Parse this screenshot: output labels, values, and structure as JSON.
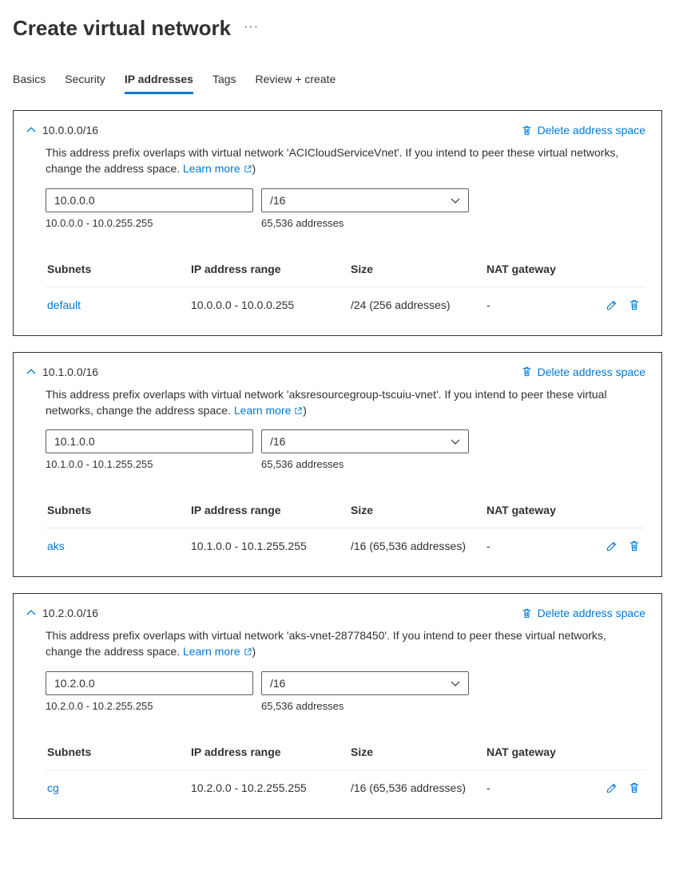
{
  "page_title": "Create virtual network",
  "tabs": {
    "basics": "Basics",
    "security": "Security",
    "ip_addresses": "IP addresses",
    "tags": "Tags",
    "review_create": "Review + create"
  },
  "delete_label": "Delete address space",
  "learn_more_label": "Learn more",
  "table_headers": {
    "subnets": "Subnets",
    "range": "IP address range",
    "size": "Size",
    "nat": "NAT gateway"
  },
  "spaces": [
    {
      "cidr": "10.0.0.0/16",
      "warning": "This address prefix overlaps with virtual network 'ACICloudServiceVnet'. If you intend to peer these virtual networks, change the address space.  ",
      "ip_value": "10.0.0.0",
      "mask_value": "/16",
      "range_text": "10.0.0.0 - 10.0.255.255",
      "count_text": "65,536 addresses",
      "subnets": [
        {
          "name": "default",
          "range": "10.0.0.0 - 10.0.0.255",
          "size": "/24 (256 addresses)",
          "nat": "-"
        }
      ]
    },
    {
      "cidr": "10.1.0.0/16",
      "warning": "This address prefix overlaps with virtual network 'aksresourcegroup-tscuiu-vnet'. If you intend to peer these virtual networks, change the address space.  ",
      "ip_value": "10.1.0.0",
      "mask_value": "/16",
      "range_text": "10.1.0.0 - 10.1.255.255",
      "count_text": "65,536 addresses",
      "subnets": [
        {
          "name": "aks",
          "range": "10.1.0.0 - 10.1.255.255",
          "size": "/16 (65,536 addresses)",
          "nat": "-"
        }
      ]
    },
    {
      "cidr": "10.2.0.0/16",
      "warning": "This address prefix overlaps with virtual network 'aks-vnet-28778450'. If you intend to peer these virtual networks, change the address space.  ",
      "ip_value": "10.2.0.0",
      "mask_value": "/16",
      "range_text": "10.2.0.0 - 10.2.255.255",
      "count_text": "65,536 addresses",
      "subnets": [
        {
          "name": "cg",
          "range": "10.2.0.0 - 10.2.255.255",
          "size": "/16 (65,536 addresses)",
          "nat": "-"
        }
      ]
    }
  ]
}
